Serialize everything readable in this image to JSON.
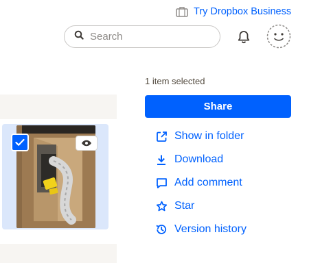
{
  "header": {
    "promo_label": "Try Dropbox Business",
    "search": {
      "placeholder": "Search",
      "value": ""
    },
    "icons": [
      "briefcase-icon",
      "search-icon",
      "bell-icon",
      "avatar-smiley-icon"
    ]
  },
  "selection": {
    "status": "1 item selected",
    "share_label": "Share"
  },
  "actions": [
    {
      "label": "Show in folder",
      "icon": "open-external-icon"
    },
    {
      "label": "Download",
      "icon": "download-icon"
    },
    {
      "label": "Add comment",
      "icon": "comment-icon"
    },
    {
      "label": "Star",
      "icon": "star-icon"
    },
    {
      "label": "Version history",
      "icon": "version-history-icon"
    }
  ],
  "file_tile": {
    "selected": true,
    "icons": [
      "checkbox-checked-icon",
      "preview-eye-icon"
    ]
  },
  "colors": {
    "accent": "#0061fe",
    "selected_tile": "#dbe7fb",
    "muted_text": "#524a3e"
  }
}
